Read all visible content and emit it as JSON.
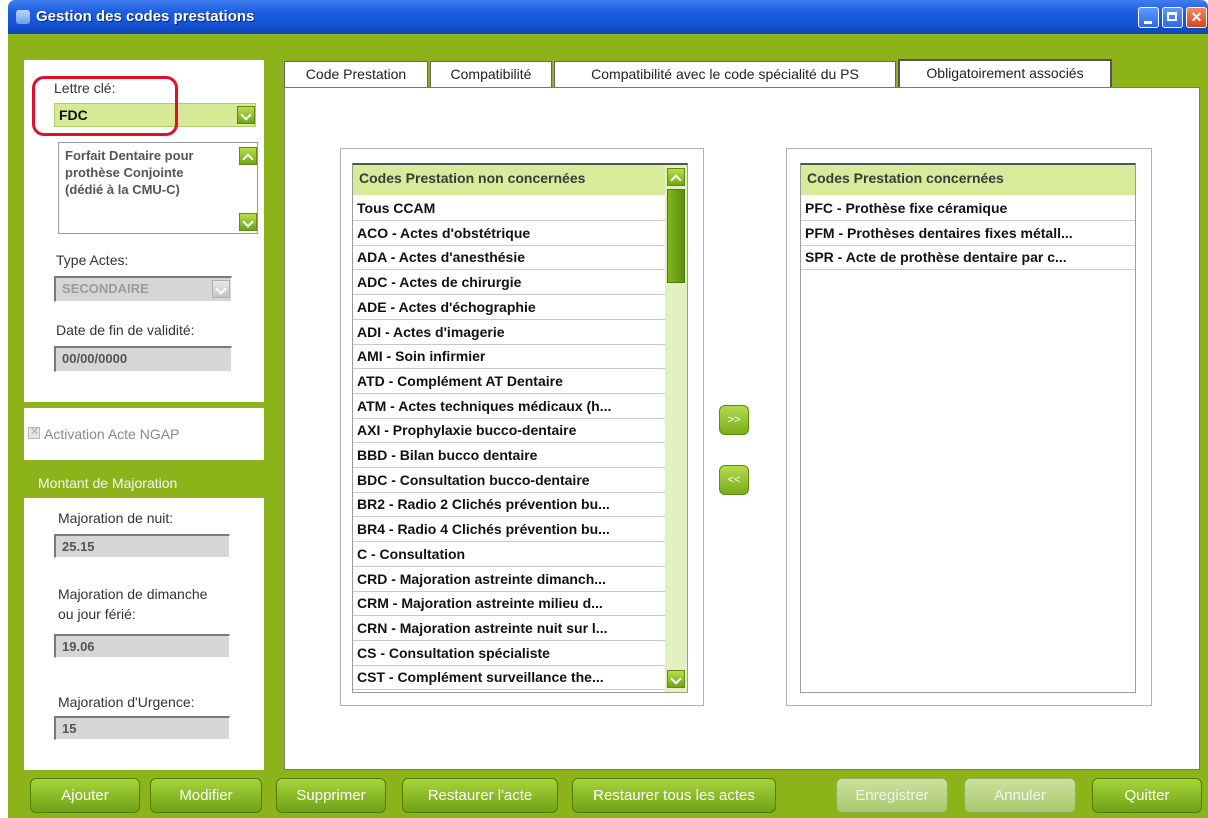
{
  "window": {
    "title": "Gestion des codes prestations"
  },
  "left": {
    "lettre_cle_label": "Lettre clé:",
    "lettre_cle_value": "FDC",
    "description": "Forfait Dentaire pour prothèse Conjointe (dédié à la CMU-C)",
    "type_actes_label": "Type Actes:",
    "type_actes_value": "SECONDAIRE",
    "date_fin_label": "Date de fin de validité:",
    "date_fin_value": "00/00/0000",
    "activation_label": "Activation Acte NGAP",
    "majoration_header": "Montant de Majoration",
    "nuit_label": "Majoration de nuit:",
    "nuit_value": "25.15",
    "dimanche_label_1": "Majoration de dimanche",
    "dimanche_label_2": "ou jour férié:",
    "dimanche_value": "19.06",
    "urgence_label": "Majoration d'Urgence:",
    "urgence_value": "15"
  },
  "tabs": [
    "Code Prestation",
    "Compatibilité",
    "Compatibilité avec le code spécialité du PS",
    "Obligatoirement associés"
  ],
  "non_concernees": {
    "header": "Codes Prestation non concernées",
    "items": [
      "Tous CCAM",
      "ACO - Actes d'obstétrique",
      "ADA - Actes d'anesthésie",
      "ADC - Actes de chirurgie",
      "ADE - Actes d'échographie",
      "ADI - Actes d'imagerie",
      "AMI - Soin infirmier",
      "ATD - Complément AT Dentaire",
      "ATM - Actes techniques médicaux (h...",
      "AXI - Prophylaxie bucco-dentaire",
      "BBD - Bilan bucco dentaire",
      "BDC - Consultation bucco-dentaire",
      "BR2 - Radio 2 Clichés prévention bu...",
      "BR4 - Radio 4 Clichés prévention bu...",
      "C - Consultation",
      "CRD - Majoration astreinte dimanch...",
      "CRM - Majoration astreinte milieu d...",
      "CRN - Majoration astreinte nuit sur l...",
      "CS - Consultation spécialiste",
      "CST - Complément surveillance the..."
    ]
  },
  "concernees": {
    "header": "Codes Prestation concernées",
    "items": [
      "PFC - Prothèse fixe céramique",
      "PFM - Prothèses dentaires fixes métall...",
      "SPR - Acte de prothèse dentaire par c..."
    ]
  },
  "transfer": {
    "add": ">>",
    "remove": "<<"
  },
  "buttons": {
    "ajouter": "Ajouter",
    "modifier": "Modifier",
    "supprimer": "Supprimer",
    "restaurer_acte": "Restaurer l'acte",
    "restaurer_tous": "Restaurer tous les actes",
    "enregistrer": "Enregistrer",
    "annuler": "Annuler",
    "quitter": "Quitter"
  },
  "colors": {
    "accent_green": "#8cb31a",
    "title_blue": "#1d5fe0",
    "highlight_red": "#e0102a"
  }
}
